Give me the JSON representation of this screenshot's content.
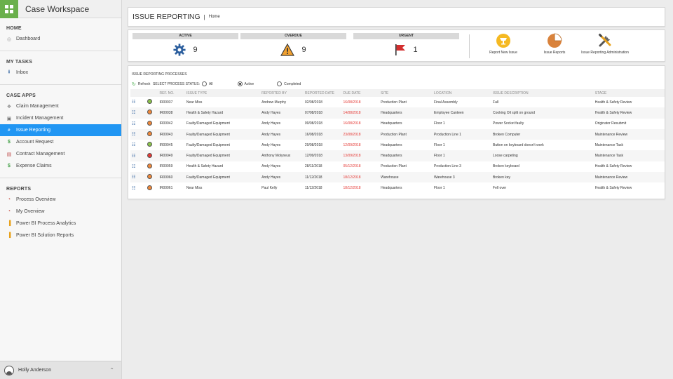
{
  "app": {
    "title": "Case Workspace"
  },
  "sidebar": {
    "sections": [
      {
        "title": "HOME",
        "items": [
          {
            "label": "Dashboard",
            "icon": "dashboard-icon"
          }
        ]
      },
      {
        "title": "MY TASKS",
        "items": [
          {
            "label": "Inbox",
            "icon": "inbox-icon"
          }
        ]
      },
      {
        "title": "CASE APPS",
        "items": [
          {
            "label": "Claim Management",
            "icon": "claim-icon"
          },
          {
            "label": "Incident Management",
            "icon": "incident-icon"
          },
          {
            "label": "Issue Reporting",
            "icon": "search-icon",
            "active": true
          },
          {
            "label": "Account Request",
            "icon": "dollar-icon"
          },
          {
            "label": "Contract Management",
            "icon": "contract-icon"
          },
          {
            "label": "Expense Claims",
            "icon": "dollar-icon"
          }
        ]
      },
      {
        "title": "REPORTS",
        "items": [
          {
            "label": "Process Overview",
            "icon": "pie-chart-icon"
          },
          {
            "label": "My Overview",
            "icon": "pie-chart-icon"
          },
          {
            "label": "Power BI Process Analytics",
            "icon": "bar-chart-icon"
          },
          {
            "label": "Power BI Solution Reports",
            "icon": "bar-chart-icon"
          }
        ]
      }
    ],
    "user": {
      "name": "Holly Anderson"
    }
  },
  "header": {
    "title": "ISSUE REPORTING",
    "separator": "|",
    "breadcrumb": "Home"
  },
  "stats": [
    {
      "label": "ACTIVE",
      "value": "9",
      "icon": "gear-icon"
    },
    {
      "label": "OVERDUE",
      "value": "9",
      "icon": "warning-icon"
    },
    {
      "label": "URGENT",
      "value": "1",
      "icon": "flag-icon"
    }
  ],
  "actions": [
    {
      "label": "Report New Issue",
      "icon": "report-issue-icon"
    },
    {
      "label": "Issue Reports",
      "icon": "pie-report-icon"
    },
    {
      "label": "Issue Reporting Administration",
      "icon": "tools-icon"
    }
  ],
  "processes": {
    "title": "ISSUE REPORTING PROCESSES",
    "refresh_label": "Refresh",
    "filter_label": "SELECT PROCESS STATUS:",
    "filter_options": [
      "All",
      "Active",
      "Completed"
    ],
    "filter_selected": "Active",
    "columns": [
      "REF. NO.",
      "ISSUE TYPE",
      "REPORTED BY",
      "REPORTED DATE",
      "DUE DATE",
      "SITE",
      "LOCATION",
      "ISSUE DESCRIPTION",
      "STAGE"
    ],
    "status_colors": {
      "green": "#8bc34a",
      "orange": "#f0883a",
      "red": "#e53935"
    },
    "rows": [
      {
        "status": "green",
        "ref": "IR00037",
        "type": "Near Miss",
        "by": "Andrew Murphy",
        "reported": "02/08/2018",
        "due": "16/08/2018",
        "site": "Production Plant",
        "location": "Final Assembly",
        "desc": "Fall",
        "stage": "Health & Safety Review"
      },
      {
        "status": "orange",
        "ref": "IR00038",
        "type": "Health & Safety Hazard",
        "by": "Andy Hayes",
        "reported": "07/08/2018",
        "due": "14/08/2018",
        "site": "Headquarters",
        "location": "Employee Canteen",
        "desc": "Cooking Oil split on ground",
        "stage": "Health & Safety Review"
      },
      {
        "status": "orange",
        "ref": "IR00042",
        "type": "Faulty/Damaged Equipment",
        "by": "Andy Hayes",
        "reported": "09/08/2018",
        "due": "16/08/2018",
        "site": "Headquarters",
        "location": "Floor 1",
        "desc": "Power Socket faulty",
        "stage": "Originator Resubmit"
      },
      {
        "status": "orange",
        "ref": "IR00043",
        "type": "Faulty/Damaged Equipment",
        "by": "Andy Hayes",
        "reported": "16/08/2018",
        "due": "23/08/2018",
        "site": "Production Plant",
        "location": "Production Line 1",
        "desc": "Broken Computer",
        "stage": "Maintenance Review"
      },
      {
        "status": "green",
        "ref": "IR00045",
        "type": "Faulty/Damaged Equipment",
        "by": "Andy Hayes",
        "reported": "29/08/2018",
        "due": "12/09/2018",
        "site": "Headquarters",
        "location": "Floor 1",
        "desc": "Button on keyboard doesn't work",
        "stage": "Maintenance Task"
      },
      {
        "status": "red",
        "ref": "IR00049",
        "type": "Faulty/Damaged Equipment",
        "by": "Anthony Molyneux",
        "reported": "12/09/2018",
        "due": "13/09/2018",
        "site": "Headquarters",
        "location": "Floor 1",
        "desc": "Loose carpeting",
        "stage": "Maintenance Task"
      },
      {
        "status": "orange",
        "ref": "IR00059",
        "type": "Health & Safety Hazard",
        "by": "Andy Hayes",
        "reported": "28/11/2018",
        "due": "05/12/2018",
        "site": "Production Plant",
        "location": "Production Line 3",
        "desc": "Broken keyboard",
        "stage": "Health & Safety Review"
      },
      {
        "status": "orange",
        "ref": "IR00060",
        "type": "Faulty/Damaged Equipment",
        "by": "Andy Hayes",
        "reported": "11/12/2018",
        "due": "18/12/2018",
        "site": "Warehouse",
        "location": "Warehouse 3",
        "desc": "Broken key",
        "stage": "Maintenance Review"
      },
      {
        "status": "orange",
        "ref": "IR00061",
        "type": "Near Miss",
        "by": "Paul Kelly",
        "reported": "11/12/2018",
        "due": "18/12/2018",
        "site": "Headquarters",
        "location": "Floor 1",
        "desc": "Fell over",
        "stage": "Health & Safety Review"
      }
    ]
  }
}
